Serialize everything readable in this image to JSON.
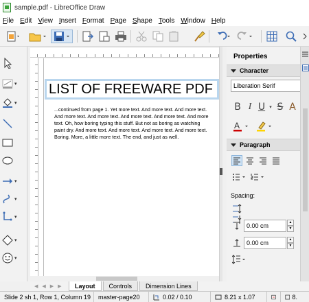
{
  "window": {
    "title": "sample.pdf - LibreOffice Draw"
  },
  "menubar": {
    "items": [
      "File",
      "Edit",
      "View",
      "Insert",
      "Format",
      "Page",
      "Shape",
      "Tools",
      "Window",
      "Help"
    ]
  },
  "toolbar": {
    "icons": [
      "new-icon",
      "open-icon",
      "save-icon",
      "export-icon",
      "export-pdf-icon",
      "print-icon",
      "cut-icon",
      "copy-icon",
      "paste-icon",
      "clone-formatting-icon",
      "undo-icon",
      "redo-icon",
      "grid-icon",
      "zoom-icon"
    ]
  },
  "left_tools": {
    "icons": [
      "select-icon",
      "line-color-icon",
      "fill-color-icon",
      "line-icon",
      "rectangle-icon",
      "ellipse-icon",
      "arrow-icon",
      "curve-icon",
      "connector-icon",
      "diamond-icon",
      "smiley-icon"
    ]
  },
  "document": {
    "title_text": "LIST OF FREEWARE PDF",
    "body_lines": [
      "...continued from page 1. Yet more text. And more text. And more text.",
      "And more text. And more text. And more text. And more text. And more",
      "text. Oh, how boring typing this stuff. But not as boring as watching",
      "paint dry. And more text. And more text. And more text. And more text.",
      "Boring.  More, a little more text. The end, and just as well."
    ]
  },
  "sidebar": {
    "title": "Properties",
    "character_section": "Character",
    "font_name": "Liberation Serif",
    "format_buttons": [
      "B",
      "I",
      "U",
      "S",
      "A"
    ],
    "paragraph_section": "Paragraph",
    "spacing_label": "Spacing:",
    "spacing_above": "0.00 cm",
    "spacing_below": "0.00 cm",
    "colors": {
      "font_color": "#cc0000",
      "highlight": "#ffd400",
      "accent": "#3a6fb0"
    }
  },
  "tabs": [
    {
      "label": "Layout",
      "active": true
    },
    {
      "label": "Controls",
      "active": false
    },
    {
      "label": "Dimension Lines",
      "active": false
    }
  ],
  "status": {
    "slide_info": "Slide 2 sh 1, Row 1, Column 19",
    "master_page": "master-page20",
    "position": "0.02 / 0.10",
    "size": "8.21 x 1.07",
    "zoom": "8."
  }
}
